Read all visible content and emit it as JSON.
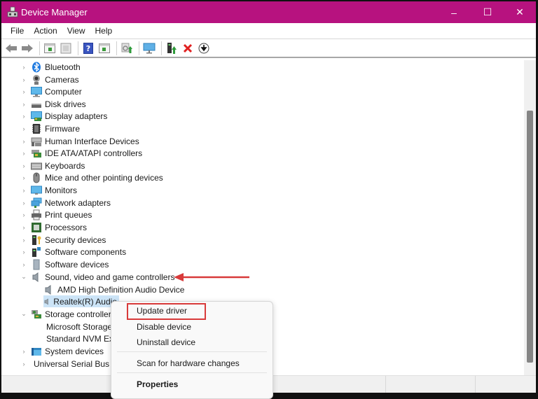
{
  "window": {
    "title": "Device Manager",
    "accent_color": "#b7127f",
    "controls": {
      "minimize": "–",
      "maximize": "☐",
      "close": "✕"
    }
  },
  "menubar": {
    "items": [
      "File",
      "Action",
      "View",
      "Help"
    ]
  },
  "toolbar": {
    "buttons": [
      "back-icon",
      "forward-icon",
      "show-hide-console-tree-icon",
      "properties-icon",
      "help-icon",
      "action-pane-icon",
      "scan-hardware-icon",
      "monitor-icon",
      "update-driver-icon",
      "uninstall-icon",
      "disable-device-icon"
    ]
  },
  "tree": {
    "categories": [
      {
        "label": "Bluetooth",
        "icon": "bluetooth-icon",
        "expanded": false
      },
      {
        "label": "Cameras",
        "icon": "camera-icon",
        "expanded": false
      },
      {
        "label": "Computer",
        "icon": "computer-icon",
        "expanded": false
      },
      {
        "label": "Disk drives",
        "icon": "disk-drive-icon",
        "expanded": false
      },
      {
        "label": "Display adapters",
        "icon": "display-adapter-icon",
        "expanded": false
      },
      {
        "label": "Firmware",
        "icon": "firmware-icon",
        "expanded": false
      },
      {
        "label": "Human Interface Devices",
        "icon": "hid-icon",
        "expanded": false
      },
      {
        "label": "IDE ATA/ATAPI controllers",
        "icon": "ide-controller-icon",
        "expanded": false
      },
      {
        "label": "Keyboards",
        "icon": "keyboard-icon",
        "expanded": false
      },
      {
        "label": "Mice and other pointing devices",
        "icon": "mouse-icon",
        "expanded": false
      },
      {
        "label": "Monitors",
        "icon": "monitor-icon",
        "expanded": false
      },
      {
        "label": "Network adapters",
        "icon": "network-adapter-icon",
        "expanded": false
      },
      {
        "label": "Print queues",
        "icon": "printer-icon",
        "expanded": false
      },
      {
        "label": "Processors",
        "icon": "processor-icon",
        "expanded": false
      },
      {
        "label": "Security devices",
        "icon": "security-device-icon",
        "expanded": false
      },
      {
        "label": "Software components",
        "icon": "software-component-icon",
        "expanded": false
      },
      {
        "label": "Software devices",
        "icon": "software-device-icon",
        "expanded": false
      },
      {
        "label": "Sound, video and game controllers",
        "icon": "speaker-icon",
        "expanded": true,
        "children": [
          {
            "label": "AMD High Definition Audio Device",
            "icon": "speaker-icon"
          },
          {
            "label": "Realtek(R) Audio",
            "icon": "speaker-icon",
            "selected": true
          }
        ]
      },
      {
        "label": "Storage controllers",
        "icon": "storage-controller-icon",
        "expanded": true,
        "children": [
          {
            "label": "Microsoft Storage Spaces Controller",
            "icon": "storage-controller-icon"
          },
          {
            "label": "Standard NVM Express Controller",
            "icon": "storage-controller-icon"
          }
        ]
      },
      {
        "label": "System devices",
        "icon": "system-devices-icon",
        "expanded": false
      },
      {
        "label": "Universal Serial Bus controllers",
        "icon": "usb-icon",
        "expanded": false
      }
    ]
  },
  "context_menu": {
    "items": [
      "Update driver",
      "Disable device",
      "Uninstall device",
      "Scan for hardware changes",
      "Properties"
    ],
    "highlighted": "Update driver",
    "highlight_color": "#d83a3a"
  },
  "annotation": {
    "arrow_color": "#d83a3a",
    "points_to": "Sound, video and game controllers"
  }
}
